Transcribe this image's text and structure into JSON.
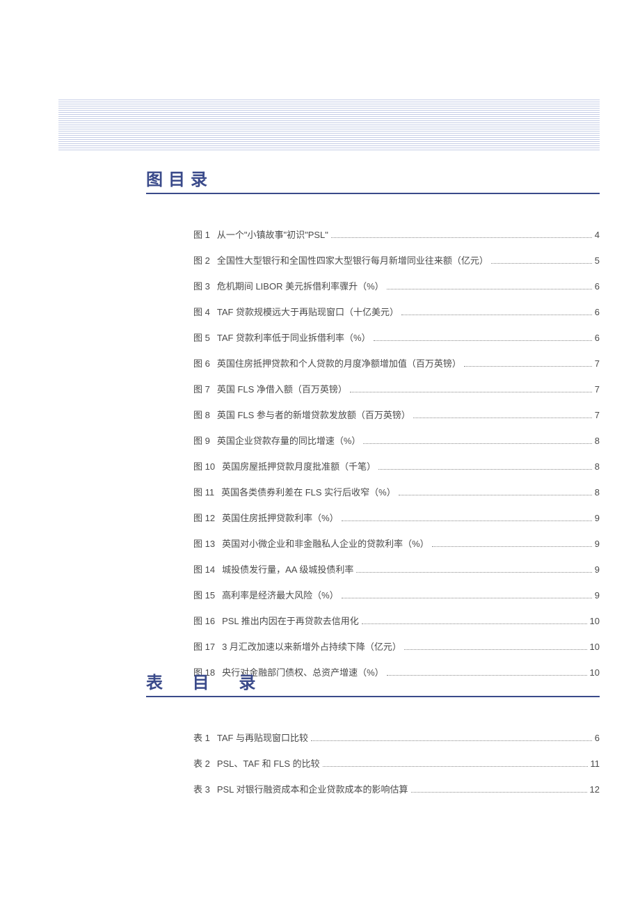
{
  "sections": {
    "figures": {
      "heading": "图目录",
      "items": [
        {
          "label": "图 1",
          "title": "从一个\"小镇故事\"初识\"PSL\"",
          "page": "4"
        },
        {
          "label": "图 2",
          "title": "全国性大型银行和全国性四家大型银行每月新增同业往来额（亿元）",
          "page": "5"
        },
        {
          "label": "图 3",
          "title": "危机期间 LIBOR 美元拆借利率骤升（%）",
          "page": "6"
        },
        {
          "label": "图 4",
          "title": "TAF 贷款规模远大于再贴现窗口（十亿美元）",
          "page": "6"
        },
        {
          "label": "图 5",
          "title": "TAF 贷款利率低于同业拆借利率（%）",
          "page": "6"
        },
        {
          "label": "图 6",
          "title": "英国住房抵押贷款和个人贷款的月度净额增加值（百万英镑）",
          "page": "7"
        },
        {
          "label": "图 7",
          "title": "英国 FLS 净借入额（百万英镑）",
          "page": "7"
        },
        {
          "label": "图 8",
          "title": "英国 FLS 参与者的新增贷款发放额（百万英镑）",
          "page": "7"
        },
        {
          "label": "图 9",
          "title": "英国企业贷款存量的同比增速（%）",
          "page": "8"
        },
        {
          "label": "图 10",
          "title": "英国房屋抵押贷款月度批准额（千笔）",
          "page": "8"
        },
        {
          "label": "图 11",
          "title": "英国各类债券利差在 FLS 实行后收窄（%）",
          "page": "8"
        },
        {
          "label": "图 12",
          "title": "英国住房抵押贷款利率（%）",
          "page": "9"
        },
        {
          "label": "图 13",
          "title": "英国对小微企业和非金融私人企业的贷款利率（%）",
          "page": "9"
        },
        {
          "label": "图 14",
          "title": "城投债发行量，AA 级城投债利率",
          "page": "9"
        },
        {
          "label": "图 15",
          "title": "高利率是经济最大风险（%）",
          "page": "9"
        },
        {
          "label": "图 16",
          "title": "PSL 推出内因在于再贷款去信用化",
          "page": "10"
        },
        {
          "label": "图 17",
          "title": "3 月汇改加速以来新增外占持续下降（亿元）",
          "page": "10"
        },
        {
          "label": "图 18",
          "title": "央行对金融部门债权、总资产增速（%）",
          "page": "10"
        }
      ]
    },
    "tables": {
      "heading": "表 目 录",
      "items": [
        {
          "label": "表 1",
          "title": "TAF 与再贴现窗口比较",
          "page": "6"
        },
        {
          "label": "表 2",
          "title": "PSL、TAF 和 FLS 的比较",
          "page": "11"
        },
        {
          "label": "表 3",
          "title": "PSL 对银行融资成本和企业贷款成本的影响估算",
          "page": "12"
        }
      ]
    }
  }
}
